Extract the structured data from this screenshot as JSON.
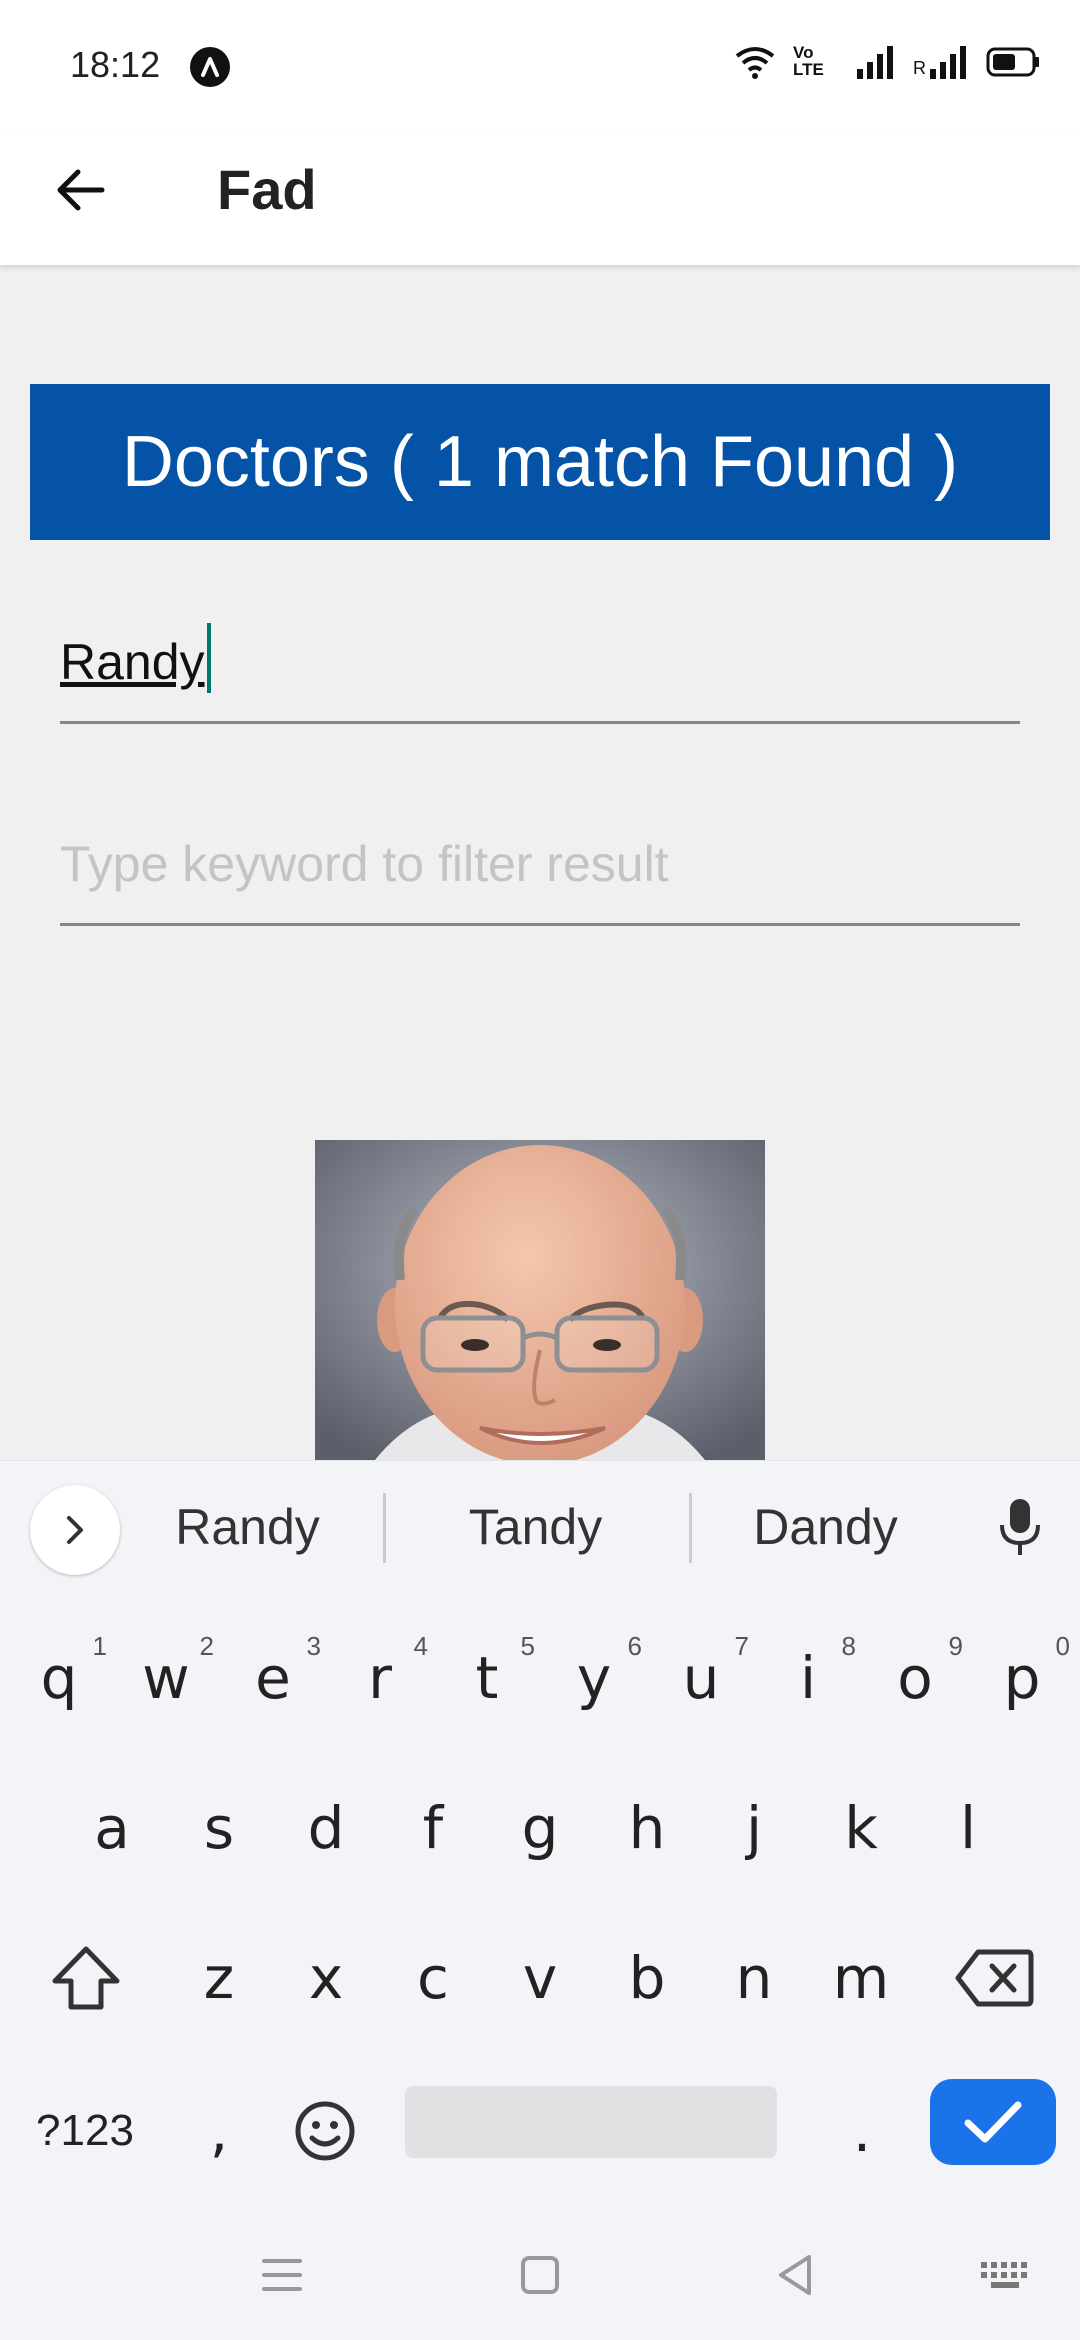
{
  "status_bar": {
    "time": "18:12",
    "icons": [
      "app-notification-icon",
      "wifi-icon",
      "volte-icon",
      "signal-icon",
      "roaming-signal-icon",
      "battery-icon"
    ],
    "volte_label": "Vo LTE",
    "roaming_label": "R"
  },
  "app_bar": {
    "title": "Fad",
    "back_icon": "arrow-left-icon"
  },
  "results_header": {
    "text": "Doctors ( 1 match Found )",
    "background": "#0553a6"
  },
  "search": {
    "name_value": "Randy",
    "filter_placeholder": "Type keyword to filter result"
  },
  "doctor_photo": {
    "description": "photo"
  },
  "keyboard": {
    "suggestions": [
      "Randy",
      "Tandy",
      "Dandy"
    ],
    "row1": [
      {
        "key": "q",
        "hint": "1"
      },
      {
        "key": "w",
        "hint": "2"
      },
      {
        "key": "e",
        "hint": "3"
      },
      {
        "key": "r",
        "hint": "4"
      },
      {
        "key": "t",
        "hint": "5"
      },
      {
        "key": "y",
        "hint": "6"
      },
      {
        "key": "u",
        "hint": "7"
      },
      {
        "key": "i",
        "hint": "8"
      },
      {
        "key": "o",
        "hint": "9"
      },
      {
        "key": "p",
        "hint": "0"
      }
    ],
    "row2": [
      "a",
      "s",
      "d",
      "f",
      "g",
      "h",
      "j",
      "k",
      "l"
    ],
    "row3": [
      "z",
      "x",
      "c",
      "v",
      "b",
      "n",
      "m"
    ],
    "symbols_key": "?123",
    "comma_key": ",",
    "period_key": ".",
    "accent": "#1a73e8"
  }
}
